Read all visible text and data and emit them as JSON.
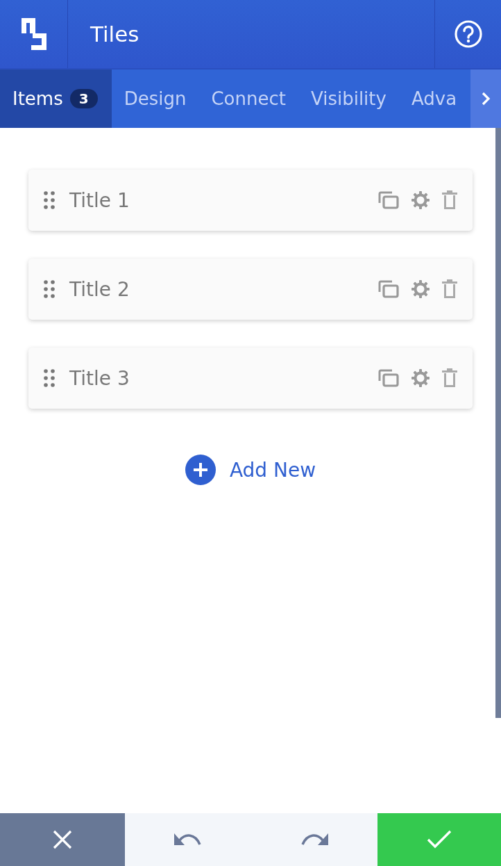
{
  "header": {
    "title": "Tiles"
  },
  "tabs": [
    {
      "label": "Items",
      "badge": "3",
      "selected": true
    },
    {
      "label": "Design",
      "selected": false
    },
    {
      "label": "Connect",
      "selected": false
    },
    {
      "label": "Visibility",
      "selected": false
    },
    {
      "label": "Adva",
      "selected": false
    }
  ],
  "items": [
    {
      "title": "Title 1"
    },
    {
      "title": "Title 2"
    },
    {
      "title": "Title 3"
    }
  ],
  "add_button": {
    "label": "Add New"
  }
}
